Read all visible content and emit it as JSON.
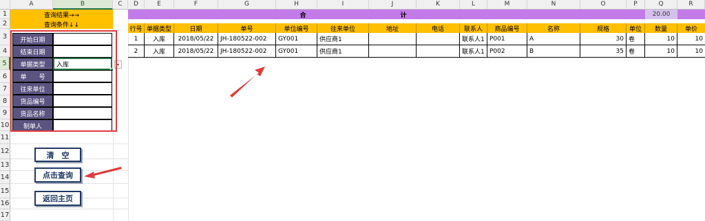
{
  "columns": [
    "A",
    "B",
    "C",
    "D",
    "E",
    "F",
    "G",
    "H",
    "I",
    "J",
    "K",
    "L",
    "M",
    "N",
    "O",
    "P",
    "Q",
    "R"
  ],
  "rows": [
    "1",
    "2",
    "3",
    "4",
    "5",
    "6",
    "7",
    "8",
    "9",
    "10",
    "11",
    "12",
    "13",
    "14",
    "15",
    "16",
    "17"
  ],
  "query": {
    "result_label": "查询结果→→",
    "condition_label": "查询条件↓↓",
    "fields": [
      {
        "label": "开始日期",
        "value": ""
      },
      {
        "label": "结束日期",
        "value": ""
      },
      {
        "label": "单据类型",
        "value": "入库"
      },
      {
        "label": "单　　号",
        "value": ""
      },
      {
        "label": "往来单位",
        "value": ""
      },
      {
        "label": "货品编号",
        "value": ""
      },
      {
        "label": "货品名称",
        "value": ""
      },
      {
        "label": "制单人",
        "value": ""
      }
    ]
  },
  "buttons": {
    "clear": "清　空",
    "query": "点击查询",
    "home": "返回主页"
  },
  "results": {
    "banner_left": "合",
    "banner_right": "计",
    "total_qty": "20.00",
    "headers": [
      "行号",
      "单据类型",
      "日期",
      "单号",
      "单位编号",
      "往来单位",
      "地址",
      "电话",
      "联系人",
      "商品编号",
      "名称",
      "规格",
      "单位",
      "数量",
      "单价"
    ],
    "rows": [
      [
        "1",
        "入库",
        "2018/05/22",
        "JH-180522-002",
        "GY001",
        "供应商1",
        "",
        "",
        "联系人1",
        "P001",
        "A",
        "30",
        "卷",
        "10",
        "10"
      ],
      [
        "2",
        "入库",
        "2018/05/22",
        "JH-180522-002",
        "GY001",
        "供应商1",
        "",
        "",
        "联系人1",
        "P002",
        "B",
        "35",
        "卷",
        "10",
        "10"
      ]
    ]
  },
  "colors": {
    "header_orange": "#ffc000",
    "banner_purple": "#c27be8",
    "label_bg": "#5c5480",
    "highlight_red": "#e03a3a",
    "button_border": "#1f3864"
  }
}
